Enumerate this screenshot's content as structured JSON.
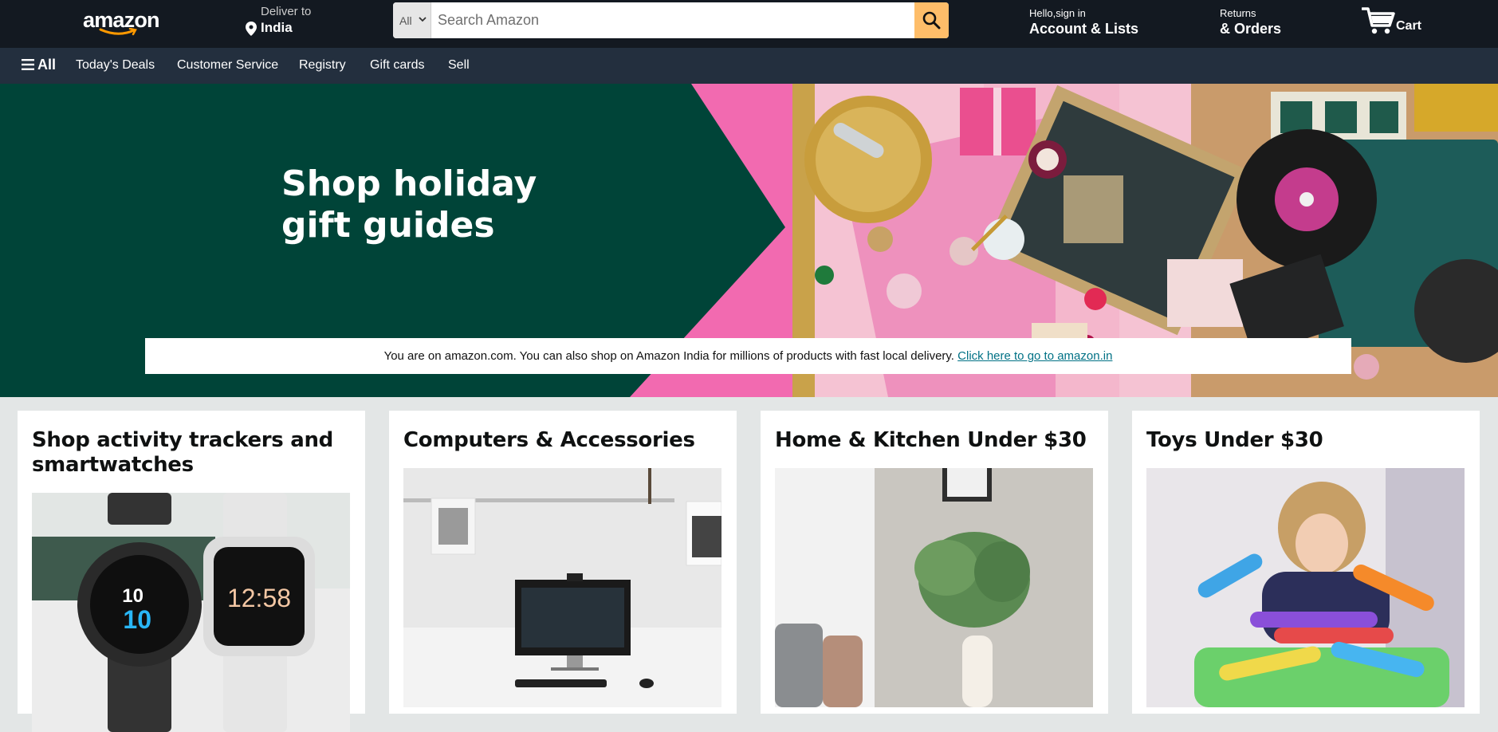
{
  "header": {
    "logo_text": "amazon",
    "deliver_to_small": "Deliver to",
    "deliver_to_location": "India",
    "search": {
      "category": "All",
      "placeholder": "Search Amazon"
    },
    "account_small": "Hello,sign in",
    "account_big": "Account & Lists",
    "returns_small": "Returns",
    "returns_big": "& Orders",
    "cart_label": "Cart"
  },
  "subnav": {
    "all_label": "All",
    "items": [
      "Today's Deals",
      "Customer Service",
      "Registry",
      "Gift cards",
      "Sell"
    ]
  },
  "hero": {
    "title_line1": "Shop holiday",
    "title_line2": "gift guides",
    "notice_text": "You are on amazon.com. You can also shop on Amazon India for millions of products with fast local delivery.",
    "notice_link": "Click here to go to amazon.in"
  },
  "cards": [
    {
      "title": "Shop activity trackers and smartwatches",
      "watch1_time": "10",
      "watch1_sub": "10",
      "watch2_time": "12:58"
    },
    {
      "title": "Computers & Accessories"
    },
    {
      "title": "Home & Kitchen Under $30"
    },
    {
      "title": "Toys Under $30"
    }
  ],
  "colors": {
    "header_bg": "#131921",
    "subnav_bg": "#232f3e",
    "search_button": "#febd69",
    "hero_green": "#004438",
    "hero_pink": "#f26ab0",
    "link": "#007185",
    "page_bg": "#e3e6e6"
  }
}
